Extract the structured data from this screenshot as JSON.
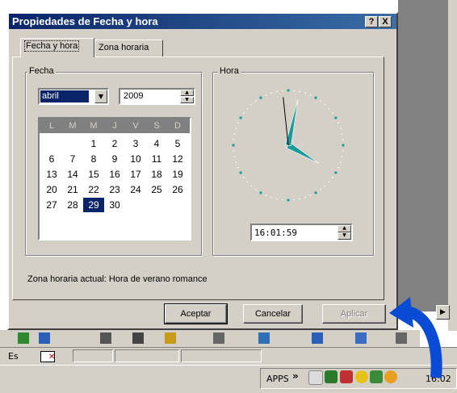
{
  "dialog": {
    "title": "Propiedades de Fecha y hora",
    "help_btn": "?",
    "close_btn": "X"
  },
  "tabs": [
    {
      "label": "Fecha y hora",
      "active": true
    },
    {
      "label": "Zona horaria",
      "active": false
    }
  ],
  "date_group": {
    "label": "Fecha",
    "month": "abril",
    "year": "2009",
    "weekdays": [
      "L",
      "M",
      "M",
      "J",
      "V",
      "S",
      "D"
    ],
    "weeks": [
      [
        "",
        "",
        "1",
        "2",
        "3",
        "4",
        "5"
      ],
      [
        "6",
        "7",
        "8",
        "9",
        "10",
        "11",
        "12"
      ],
      [
        "13",
        "14",
        "15",
        "16",
        "17",
        "18",
        "19"
      ],
      [
        "20",
        "21",
        "22",
        "23",
        "24",
        "25",
        "26"
      ],
      [
        "27",
        "28",
        "29",
        "30",
        "",
        "",
        ""
      ]
    ],
    "selected_day": "29"
  },
  "time_group": {
    "label": "Hora",
    "time_value": "16:01:59",
    "clock": {
      "hour": 16,
      "minute": 1,
      "second": 59
    }
  },
  "timezone_text": "Zona horaria actual:  Hora de verano romance",
  "buttons": {
    "ok": "Aceptar",
    "cancel": "Cancelar",
    "apply": "Aplicar"
  },
  "statusbar": {
    "lang": "Es"
  },
  "taskbar": {
    "apps_label": "APPS",
    "expand": "»",
    "clock": "16:02"
  },
  "colors": {
    "title_start": "#0a246a",
    "title_end": "#3a6ea5",
    "face": "#d4d0c8",
    "clock_hand": "#1a9a9a",
    "arrow": "#0a4bd6"
  }
}
